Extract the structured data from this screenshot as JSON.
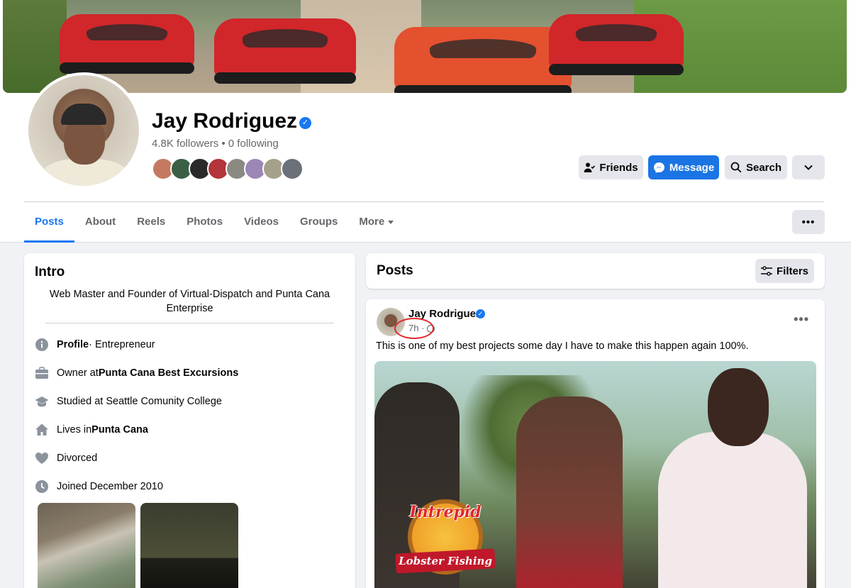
{
  "profile": {
    "name": "Jay Rodriguez",
    "verified_mark": "✓",
    "stats": "4.8K followers • 0 following"
  },
  "actions": {
    "friends_label": "Friends",
    "message_label": "Message",
    "search_label": "Search"
  },
  "tabs": [
    {
      "label": "Posts",
      "active": true
    },
    {
      "label": "About"
    },
    {
      "label": "Reels"
    },
    {
      "label": "Photos"
    },
    {
      "label": "Videos"
    },
    {
      "label": "Groups"
    },
    {
      "label": "More"
    }
  ],
  "intro": {
    "title": "Intro",
    "bio": "Web Master and Founder of Virtual-Dispatch and Punta Cana Enterprise",
    "details": [
      {
        "icon": "info-icon",
        "bold": "Profile",
        "text": " · Entrepreneur"
      },
      {
        "icon": "briefcase-icon",
        "prefix": "Owner at ",
        "bold": "Punta Cana Best Excursions"
      },
      {
        "icon": "graduation-cap-icon",
        "prefix": "Studied at Seattle Comunity College"
      },
      {
        "icon": "home-icon",
        "prefix": "Lives in ",
        "bold": "Punta Cana"
      },
      {
        "icon": "heart-icon",
        "prefix": "Divorced"
      },
      {
        "icon": "clock-icon",
        "prefix": "Joined December 2010"
      }
    ]
  },
  "posts_section": {
    "title": "Posts",
    "filters_label": "Filters"
  },
  "post": {
    "author": "Jay Rodriguez",
    "time": "7h ·",
    "text": "This is one of my best projects some day  I have to make this happen again 100%.",
    "media_logo_top": "Intrepid",
    "media_logo_bottom": "Lobster Fishing"
  },
  "colors": {
    "brand_blue": "#1877f2",
    "button_blue": "#1b74e4",
    "highlight_red": "#e0262a"
  }
}
